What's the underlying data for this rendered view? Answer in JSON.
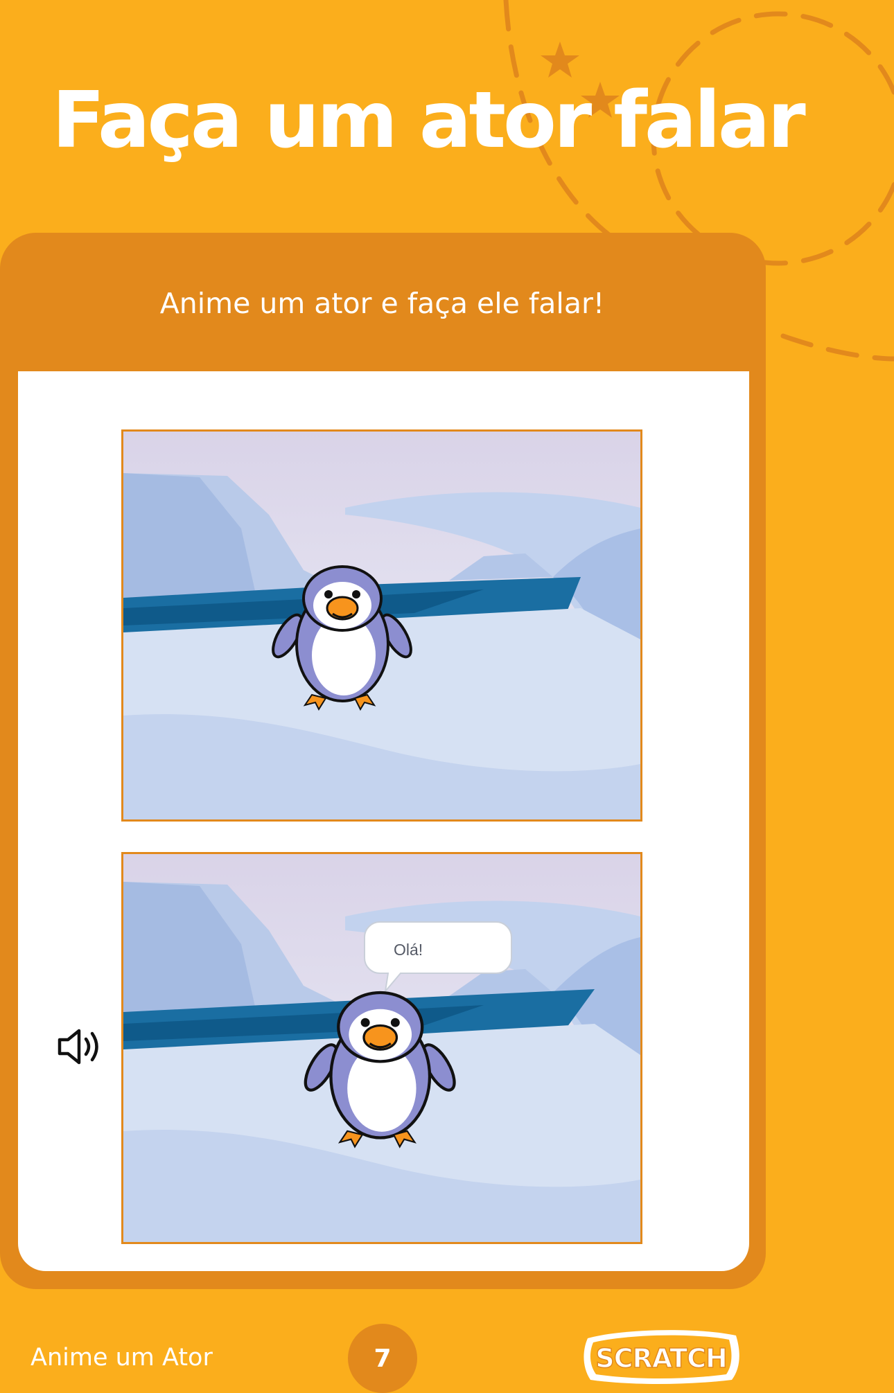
{
  "title": "Faça um ator falar",
  "card": {
    "subtitle": "Anime um ator e faça ele falar!"
  },
  "stage_bottom": {
    "speech_text": "Olá!"
  },
  "speaker_icon": "speaker-sound-icon",
  "footer": {
    "label": "Anime um Ator",
    "page_number": "7",
    "logo_text": "SCRATCH"
  },
  "colors": {
    "page_background": "#FBAE1C",
    "card_background": "#E2891C",
    "title_text": "#FFFFFF",
    "penguin_body": "#8C8ED0",
    "penguin_beak": "#F7941D"
  }
}
